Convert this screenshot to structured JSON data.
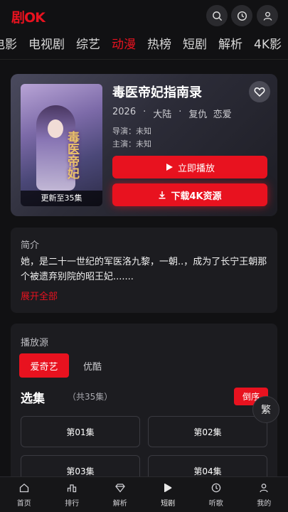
{
  "app": {
    "logo": "剧OK"
  },
  "nav_tabs": [
    "电影",
    "电视剧",
    "综艺",
    "动漫",
    "热榜",
    "短剧",
    "解析",
    "4K影"
  ],
  "active_tab_index": 3,
  "show": {
    "title": "毒医帝妃指南录",
    "year": "2026",
    "region": "大陆",
    "genres": "复仇  恋爱",
    "director_label": "导演：未知",
    "cast_label": "主演：未知",
    "poster_title": "毒医帝妃",
    "poster_footer": "更新至35集",
    "play_label": "立即播放",
    "download_label": "下载4K资源"
  },
  "intro": {
    "heading": "简介",
    "text": "她，是二十一世纪的军医洛九黎，一朝..，成为了长宁王朝那个被遗弃别院的昭王妃.......",
    "expand_label": "展开全部"
  },
  "source": {
    "heading": "播放源",
    "tabs": [
      "爱奇艺",
      "优酷"
    ],
    "active_index": 0
  },
  "episodes": {
    "heading": "选集",
    "count_label": "（共35集）",
    "sort_label": "倒序",
    "items": [
      "第01集",
      "第02集",
      "第03集",
      "第04集"
    ]
  },
  "floating": {
    "label": "繁"
  },
  "bottom_nav": [
    {
      "label": "首页",
      "icon": "home-icon"
    },
    {
      "label": "排行",
      "icon": "ranking-icon"
    },
    {
      "label": "解析",
      "icon": "diamond-icon"
    },
    {
      "label": "短剧",
      "icon": "play-icon"
    },
    {
      "label": "听歌",
      "icon": "music-icon"
    },
    {
      "label": "我的",
      "icon": "user-icon"
    }
  ],
  "colors": {
    "accent": "#e8121f",
    "background": "#111113",
    "card": "#1c1c20"
  }
}
